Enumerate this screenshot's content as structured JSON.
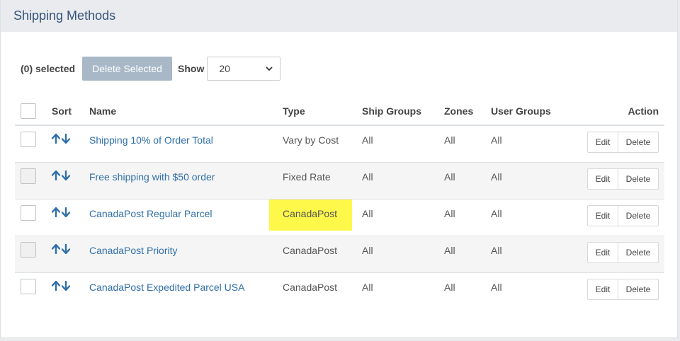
{
  "header": {
    "title": "Shipping Methods"
  },
  "toolbar": {
    "selected_count": "(0) selected",
    "delete_selected_label": "Delete Selected",
    "show_label": "Show",
    "show_value": "20"
  },
  "table": {
    "columns": {
      "sort": "Sort",
      "name": "Name",
      "type": "Type",
      "ship_groups": "Ship Groups",
      "zones": "Zones",
      "user_groups": "User Groups",
      "action": "Action"
    },
    "rows": [
      {
        "name": "Shipping 10% of Order Total",
        "type": "Vary by Cost",
        "ship_groups": "All",
        "zones": "All",
        "user_groups": "All",
        "edit": "Edit",
        "delete": "Delete"
      },
      {
        "name": "Free shipping with $50 order",
        "type": "Fixed Rate",
        "ship_groups": "All",
        "zones": "All",
        "user_groups": "All",
        "edit": "Edit",
        "delete": "Delete"
      },
      {
        "name": "CanadaPost Regular Parcel",
        "type": "CanadaPost",
        "ship_groups": "All",
        "zones": "All",
        "user_groups": "All",
        "edit": "Edit",
        "delete": "Delete"
      },
      {
        "name": "CanadaPost Priority",
        "type": "CanadaPost",
        "ship_groups": "All",
        "zones": "All",
        "user_groups": "All",
        "edit": "Edit",
        "delete": "Delete"
      },
      {
        "name": "CanadaPost Expedited Parcel USA",
        "type": "CanadaPost",
        "ship_groups": "All",
        "zones": "All",
        "user_groups": "All",
        "edit": "Edit",
        "delete": "Delete"
      }
    ]
  },
  "colors": {
    "link": "#2f6fa8",
    "title": "#36557a",
    "highlight": "#fef84b",
    "button": "#a9b8c6"
  },
  "icons": {
    "sort_up": "arrow-up-icon",
    "sort_down": "arrow-down-icon",
    "select": "chevron-down-icon"
  }
}
